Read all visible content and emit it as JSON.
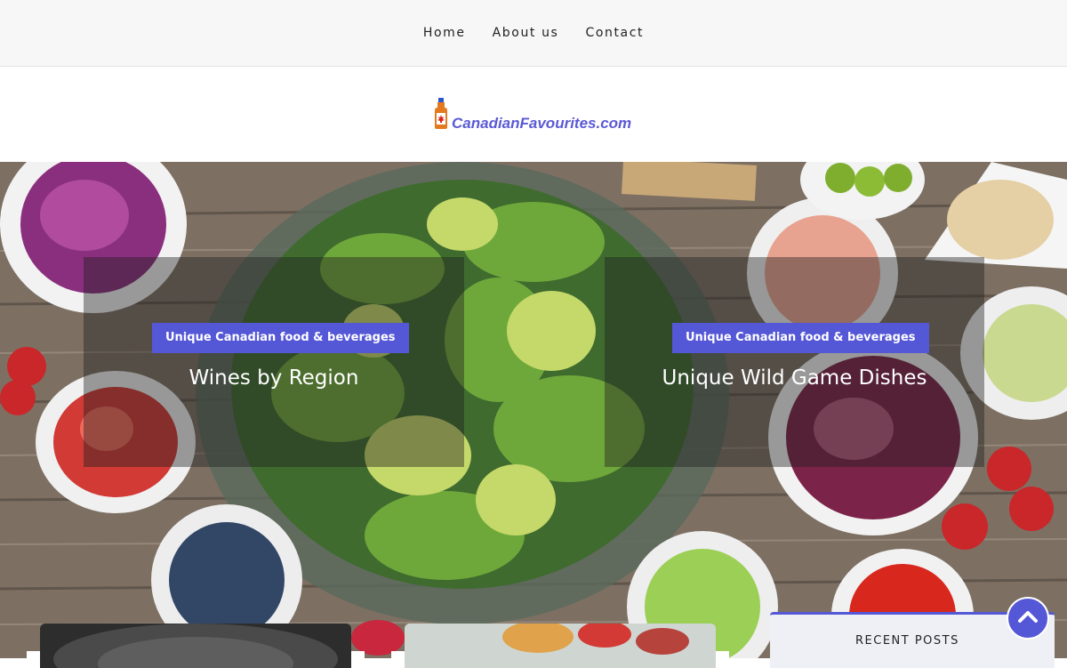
{
  "nav": {
    "items": [
      {
        "label": "Home"
      },
      {
        "label": "About us"
      },
      {
        "label": "Contact"
      }
    ]
  },
  "logo": {
    "text": "CanadianFavourites.com",
    "icon": "maple-syrup-bottle-icon"
  },
  "slides": [
    {
      "tag": "Unique Canadian food & beverages",
      "title": "Wines by Region"
    },
    {
      "tag": "Unique Canadian food & beverages",
      "title": "Unique Wild Game Dishes"
    }
  ],
  "sidebar": {
    "recent_posts_title": "RECENT POSTS"
  },
  "scroll_top": {
    "icon": "chevron-up-icon"
  },
  "colors": {
    "accent": "#5457d6",
    "logo_text": "#5a5ad6",
    "nav_bg": "#f7f7f7"
  }
}
